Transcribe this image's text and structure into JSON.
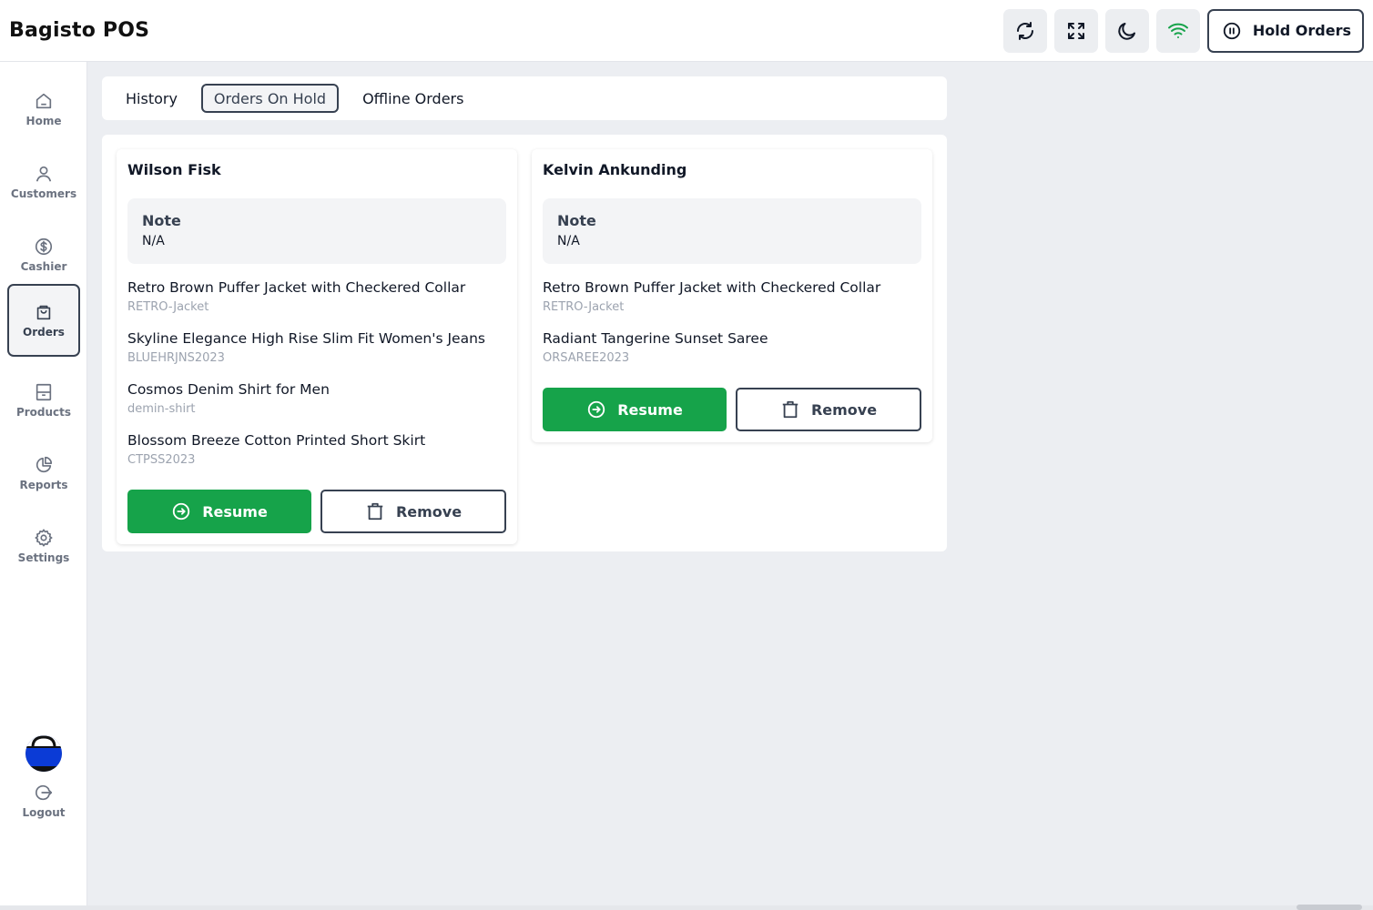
{
  "app": {
    "title": "Bagisto POS"
  },
  "header": {
    "icons": [
      "sync-icon",
      "fullscreen-icon",
      "dark-mode-icon",
      "wifi-icon"
    ],
    "hold_orders_label": "Hold Orders",
    "wifi_color": "#16a34a"
  },
  "sidebar": {
    "items": [
      {
        "label": "Home",
        "icon": "home-icon"
      },
      {
        "label": "Customers",
        "icon": "user-icon"
      },
      {
        "label": "Cashier",
        "icon": "dollar-icon"
      },
      {
        "label": "Orders",
        "icon": "bag-icon",
        "active": true
      },
      {
        "label": "Products",
        "icon": "archive-icon"
      },
      {
        "label": "Reports",
        "icon": "pie-chart-icon"
      },
      {
        "label": "Settings",
        "icon": "gear-icon"
      }
    ],
    "logout_label": "Logout"
  },
  "tabs": [
    {
      "label": "History"
    },
    {
      "label": "Orders On Hold",
      "active": true
    },
    {
      "label": "Offline Orders"
    }
  ],
  "orders": [
    {
      "customer": "Wilson Fisk",
      "note_heading": "Note",
      "note_value": "N/A",
      "items": [
        {
          "name": "Retro Brown Puffer Jacket with Checkered Collar",
          "sku": "RETRO-Jacket"
        },
        {
          "name": "Skyline Elegance High Rise Slim Fit Women's Jeans",
          "sku": "BLUEHRJNS2023"
        },
        {
          "name": "Cosmos Denim Shirt for Men",
          "sku": "demin-shirt"
        },
        {
          "name": "Blossom Breeze Cotton Printed Short Skirt",
          "sku": "CTPSS2023"
        }
      ],
      "resume_label": "Resume",
      "remove_label": "Remove"
    },
    {
      "customer": "Kelvin Ankunding",
      "note_heading": "Note",
      "note_value": "N/A",
      "items": [
        {
          "name": "Retro Brown Puffer Jacket with Checkered Collar",
          "sku": "RETRO-Jacket"
        },
        {
          "name": "Radiant Tangerine Sunset Saree",
          "sku": "ORSAREE2023"
        }
      ],
      "resume_label": "Resume",
      "remove_label": "Remove"
    }
  ],
  "colors": {
    "accent_green": "#16a34a",
    "border_dark": "#374151",
    "background": "#eceef2"
  }
}
